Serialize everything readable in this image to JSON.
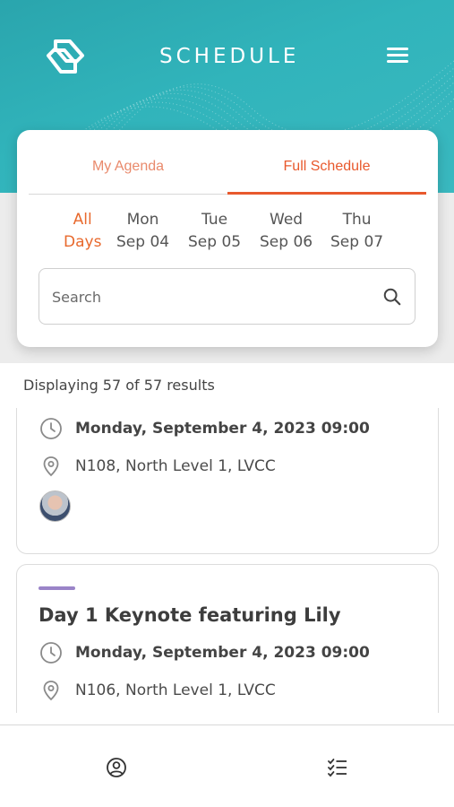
{
  "header": {
    "title": "SCHEDULE",
    "logo_icon": "brand-logo-icon",
    "menu_icon": "hamburger-menu-icon",
    "background_color": "#31b4bb"
  },
  "tabs": [
    {
      "label": "My Agenda",
      "active": false
    },
    {
      "label": "Full Schedule",
      "active": true
    }
  ],
  "accent_color": "#e8592d",
  "days": [
    {
      "line1": "All",
      "line2": "Days",
      "active": true
    },
    {
      "line1": "Mon",
      "line2": "Sep 04",
      "active": false
    },
    {
      "line1": "Tue",
      "line2": "Sep 05",
      "active": false
    },
    {
      "line1": "Wed",
      "line2": "Sep 06",
      "active": false
    },
    {
      "line1": "Thu",
      "line2": "Sep 07",
      "active": false
    }
  ],
  "search": {
    "placeholder": "Search"
  },
  "results_text": "Displaying 57 of 57 results",
  "events": [
    {
      "title": "",
      "datetime": "Monday, September 4, 2023 09:00",
      "location": "N108, North Level 1, LVCC",
      "has_speaker_avatar": true
    },
    {
      "title": "Day 1 Keynote featuring Lily",
      "track_color": "#9a84c8",
      "datetime": "Monday, September 4, 2023 09:00",
      "location": "N106, North Level 1, LVCC"
    }
  ],
  "bottom_nav": [
    {
      "icon": "profile-icon"
    },
    {
      "icon": "schedule-list-icon"
    }
  ]
}
